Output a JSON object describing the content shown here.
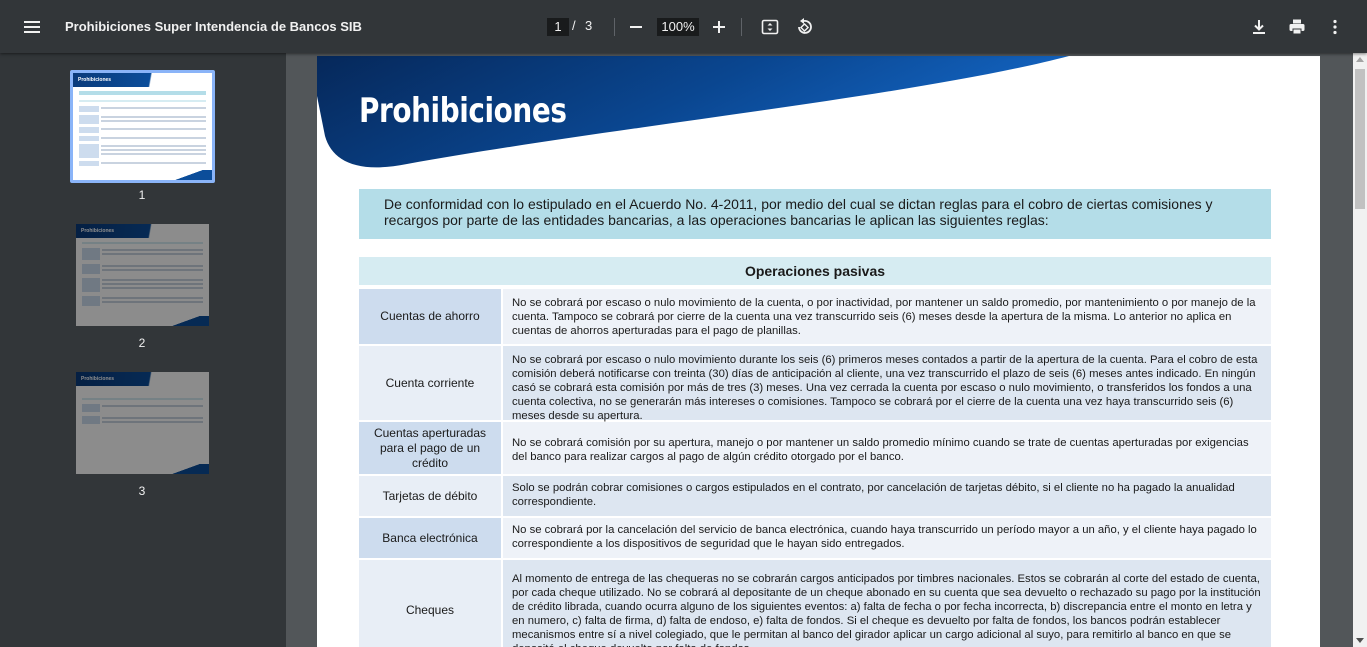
{
  "toolbar": {
    "title": "Prohibiciones Super Intendencia de Bancos SIB",
    "current_page": "1",
    "page_separator": "/",
    "total_pages": "3",
    "zoom": "100%"
  },
  "sidebar": {
    "thumbnails": [
      {
        "label": "1",
        "selected": true
      },
      {
        "label": "2",
        "selected": false
      },
      {
        "label": "3",
        "selected": false
      }
    ],
    "mini_title": "Prohibiciones"
  },
  "document": {
    "banner_title": "Prohibiciones",
    "intro": "De conformidad con lo estipulado en el Acuerdo No. 4-2011, por medio del cual se dictan reglas para el cobro de ciertas comisiones y recargos por parte de las entidades bancarias, a las operaciones bancarias le aplican las siguientes reglas:",
    "section_header": "Operaciones pasivas",
    "rows": [
      {
        "label": "Cuentas de ahorro",
        "text": "No se cobrará por escaso o nulo movimiento de la cuenta, o por inactividad, por mantener un saldo promedio, por mantenimiento o por manejo de la cuenta. Tampoco se cobrará por cierre de la cuenta una vez transcurrido seis (6) meses desde la apertura de la misma. Lo anterior no aplica en cuentas de ahorros aperturadas para el pago de planillas."
      },
      {
        "label": "Cuenta corriente",
        "text": "No se cobrará por escaso o nulo movimiento durante los seis (6) primeros meses contados a partir de la apertura de la cuenta. Para el cobro de esta comisión deberá notificarse con treinta (30) días de anticipación al cliente, una vez transcurrido el plazo de seis (6) meses antes indicado. En ningún casó se cobrará esta comisión por más de tres (3) meses. Una vez cerrada la cuenta por escaso o nulo movimiento, o transferidos los fondos a una cuenta colectiva, no se generarán más intereses o comisiones. Tampoco se cobrará por el cierre de la cuenta una vez haya transcurrido seis (6) meses desde su apertura."
      },
      {
        "label": "Cuentas aperturadas para el pago de un crédito",
        "text": "No se cobrará comisión por su apertura, manejo o por mantener un saldo promedio mínimo cuando se trate de cuentas aperturadas por exigencias del banco para realizar cargos al pago de algún crédito otorgado por el banco."
      },
      {
        "label": "Tarjetas de débito",
        "text": "Solo se podrán cobrar comisiones o cargos estipulados en el contrato, por cancelación de tarjetas débito, si el cliente no ha pagado la anualidad correspondiente."
      },
      {
        "label": "Banca electrónica",
        "text": "No se cobrará por la cancelación del servicio de banca electrónica, cuando haya transcurrido un período mayor a un año, y el cliente haya pagado lo correspondiente a los dispositivos de seguridad que le hayan sido entregados."
      },
      {
        "label": "Cheques",
        "text": "Al momento de entrega de las chequeras no se cobrarán cargos anticipados por timbres nacionales. Estos se cobrarán al corte del estado de cuenta, por cada cheque utilizado. No se cobrará al depositante de un cheque abonado en su cuenta que sea devuelto o rechazado su pago por la institución de crédito librada, cuando ocurra alguno de los siguientes eventos: a) falta de fecha o por fecha incorrecta, b) discrepancia entre el monto en letra y en numero, c) falta de firma, d) falta de endoso, e) falta de fondos. Si el cheque es devuelto por falta de fondos, los bancos podrán establecer mecanismos entre sí a nivel colegiado, que le permitan al banco del girador aplicar un cargo adicional al suyo, para remitirlo al banco en que se depositó el cheque devuelto por falta de fondos."
      }
    ]
  },
  "colors": {
    "toolbar_bg": "#323639",
    "banner_blue": "#0b4d9a",
    "intro_bg": "#b4dde8",
    "label_bg": "#cddcee"
  },
  "icons": [
    "menu-icon",
    "minus-icon",
    "plus-icon",
    "fit-page-icon",
    "rotate-icon",
    "download-icon",
    "print-icon",
    "more-vert-icon"
  ]
}
